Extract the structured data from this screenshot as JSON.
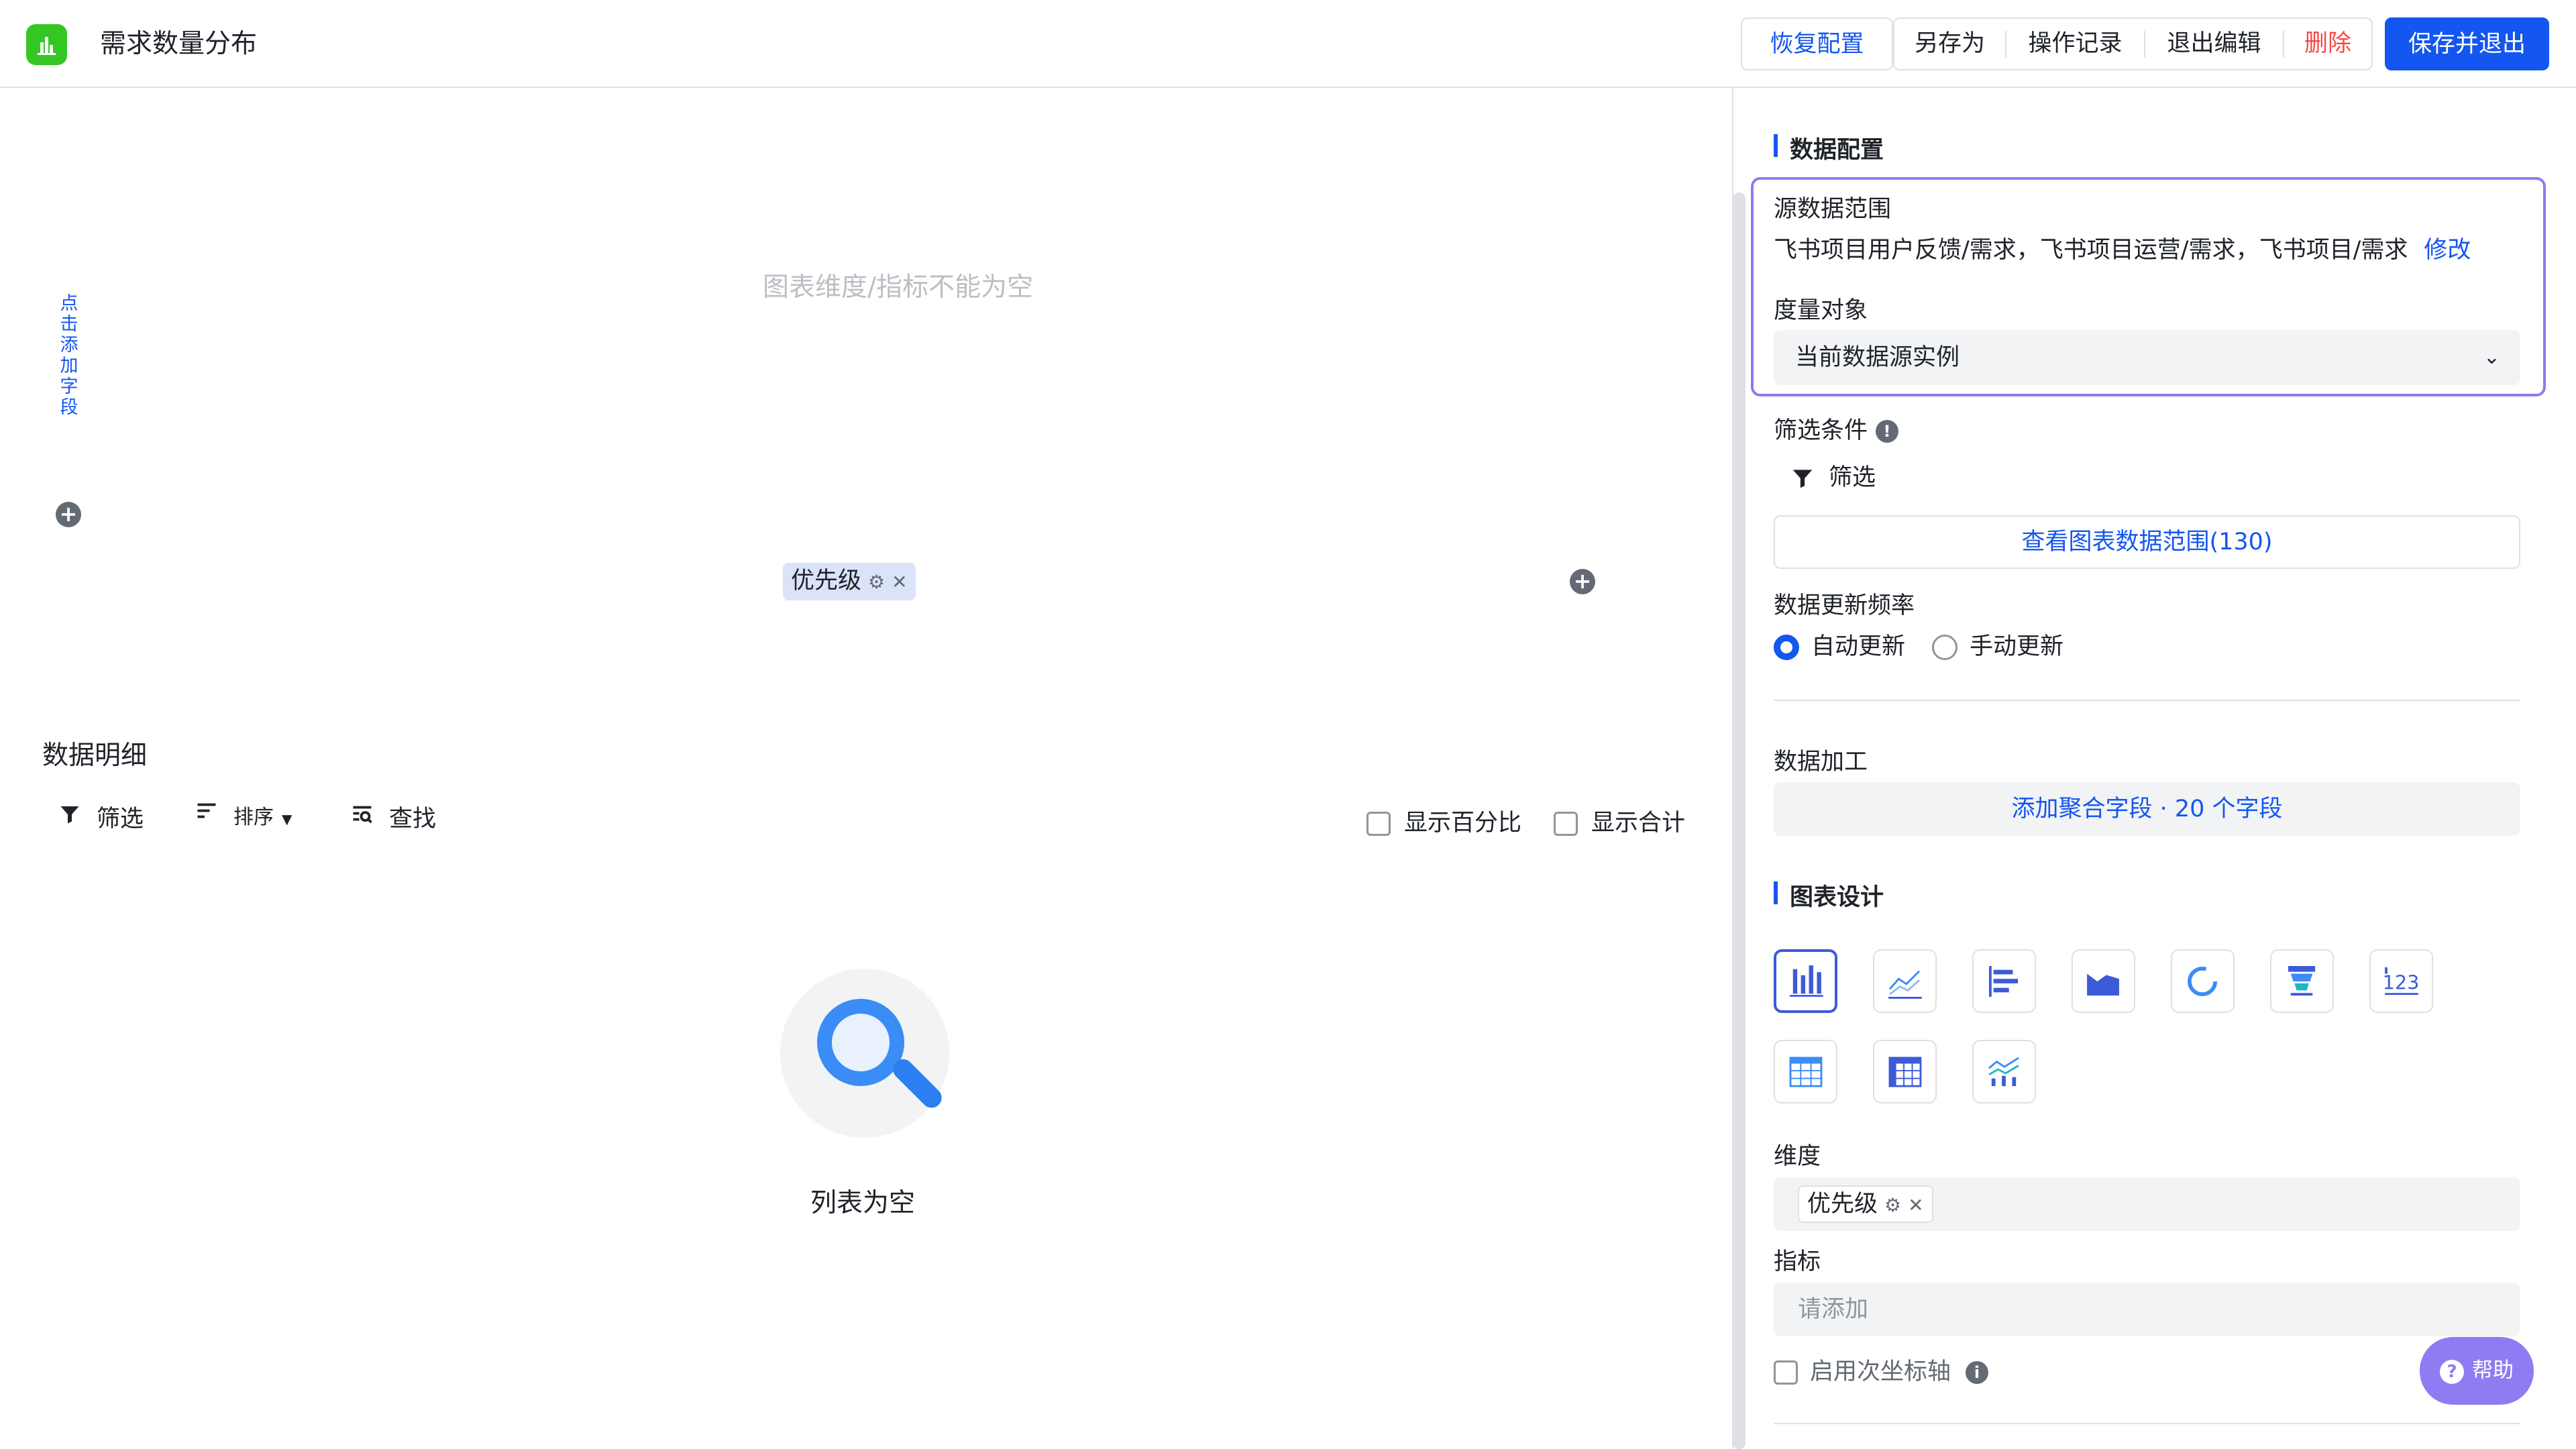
{
  "header": {
    "title": "需求数量分布",
    "logo_icon": "bar-chart-icon",
    "buttons": {
      "restore": "恢复配置",
      "save_as": "另存为",
      "history": "操作记录",
      "exit_edit": "退出编辑",
      "delete": "删除",
      "save_exit": "保存并退出"
    }
  },
  "canvas": {
    "y_axis_hint": "点击添加字段",
    "empty_hint": "图表维度/指标不能为空",
    "dimension_chip": "优先级"
  },
  "details": {
    "title": "数据明细",
    "tools": {
      "filter": "筛选",
      "sort": "排序",
      "find": "查找"
    },
    "show_percent": "显示百分比",
    "show_total": "显示合计",
    "empty_text": "列表为空"
  },
  "panel": {
    "data_config_title": "数据配置",
    "source_label": "源数据范围",
    "source_value": "飞书项目用户反馈/需求，飞书项目运营/需求，飞书项目/需求",
    "source_edit": "修改",
    "measure_label": "度量对象",
    "measure_value": "当前数据源实例",
    "filter_label": "筛选条件",
    "filter_button": "筛选",
    "view_range": "查看图表数据范围(130)",
    "frequency_label": "数据更新频率",
    "auto_update": "自动更新",
    "manual_update": "手动更新",
    "processing_label": "数据加工",
    "add_aggregate": "添加聚合字段 · 20 个字段",
    "design_title": "图表设计",
    "dimension_label": "维度",
    "dimension_chip": "优先级",
    "metric_label": "指标",
    "metric_placeholder": "请添加",
    "secondary_axis": "启用次坐标轴"
  },
  "help": "帮助",
  "colors": {
    "accent": "#1456f0",
    "danger": "#f54a45",
    "logo": "#34c724",
    "highlight_border": "#8d7bf0"
  }
}
